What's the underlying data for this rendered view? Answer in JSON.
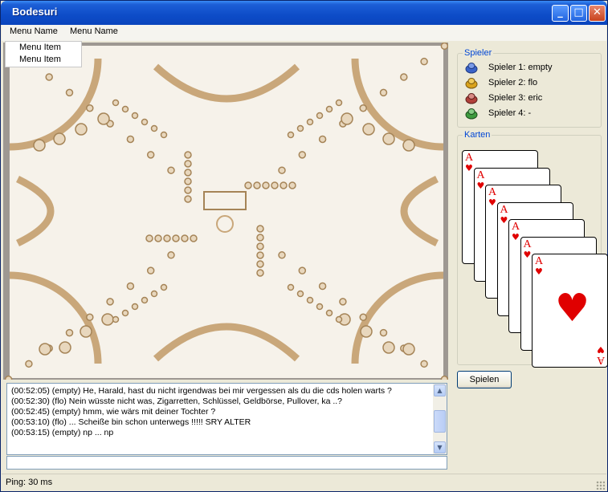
{
  "window": {
    "title": "Bodesuri"
  },
  "menubar": {
    "menus": [
      "Menu Name",
      "Menu Name"
    ]
  },
  "dropdown": {
    "items": [
      "Menu Item",
      "Menu Item"
    ]
  },
  "chat": {
    "lines": [
      "(00:52:05) (empty) He, Harald, hast du nicht irgendwas bei mir vergessen als du die cds holen warts ?",
      "(00:52:30) (flo) Nein wüsste nicht was, Zigarretten, Schlüssel, Geldbörse, Pullover, ka ..?",
      "(00:52:45) (empty) hmm, wie wärs mit deiner Tochter ?",
      "(00:53:10) (flo) ... Scheiße bin schon unterwegs !!!!! SRY ALTER",
      "(00:53:15) (empty) np ... np"
    ],
    "input_value": ""
  },
  "players": {
    "label": "Spieler",
    "list": [
      {
        "name": "Spieler 1: empty",
        "color": "#3a63c8"
      },
      {
        "name": "Spieler 2: flo",
        "color": "#d9a21c"
      },
      {
        "name": "Spieler 3: eric",
        "color": "#b0403a"
      },
      {
        "name": "Spieler 4: -",
        "color": "#3e9a3e"
      }
    ]
  },
  "cards": {
    "label": "Karten",
    "hand": [
      {
        "rank": "A",
        "suit": "♥"
      },
      {
        "rank": "A",
        "suit": "♥"
      },
      {
        "rank": "A",
        "suit": "♥"
      },
      {
        "rank": "A",
        "suit": "♥"
      },
      {
        "rank": "A",
        "suit": "♥"
      },
      {
        "rank": "A",
        "suit": "♥"
      },
      {
        "rank": "A",
        "suit": "♥"
      }
    ]
  },
  "actions": {
    "play_label": "Spielen"
  },
  "status": {
    "ping_text": "Ping: 30 ms"
  },
  "colors": {
    "title_bar": "#0a44bd",
    "board_surface": "#f6f2ea",
    "board_lines": "#c9a77a",
    "card_red": "#e00000"
  },
  "icons": {
    "minimize": "minimize-icon",
    "maximize": "maximize-icon",
    "close": "close-icon",
    "pawn": "pawn-icon",
    "scroll_up": "scroll-up-icon",
    "scroll_down": "scroll-down-icon"
  }
}
